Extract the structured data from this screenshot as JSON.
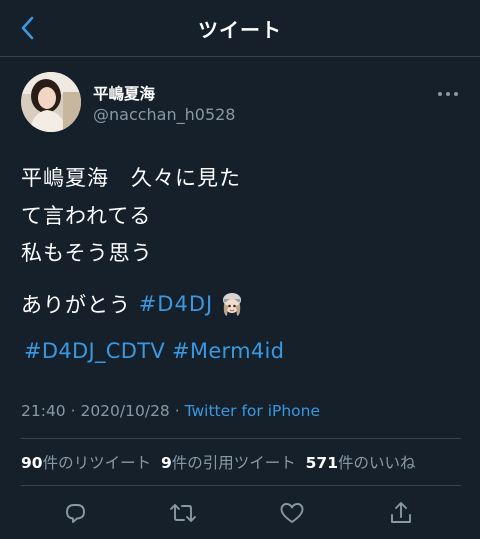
{
  "header": {
    "title": "ツイート"
  },
  "author": {
    "display_name": "平嶋夏海",
    "handle": "@nacchan_h0528"
  },
  "tweet": {
    "lines": [
      "平嶋夏海　久々に見た",
      "て言われてる",
      "私もそう思う"
    ],
    "line2_text": "ありがとう ",
    "line2_hashtag": "#D4DJ",
    "hashtags_line": [
      "#D4DJ_CDTV",
      "#Merm4id"
    ]
  },
  "meta": {
    "time": "21:40",
    "separator": " · ",
    "date": "2020/10/28",
    "source": "Twitter for iPhone"
  },
  "stats": {
    "retweets": "90",
    "retweets_label": "件のリツイート",
    "quotes": "9",
    "quotes_label": "件の引用ツイート",
    "likes": "571",
    "likes_label": "件のいいね"
  },
  "icons": {
    "back": "chevron-left-icon",
    "more": "more-icon",
    "reply": "reply-icon",
    "retweet": "retweet-icon",
    "like": "heart-icon",
    "share": "share-icon"
  },
  "colors": {
    "background": "#15202b",
    "accent": "#3a97e0",
    "secondary": "#8899a6"
  }
}
